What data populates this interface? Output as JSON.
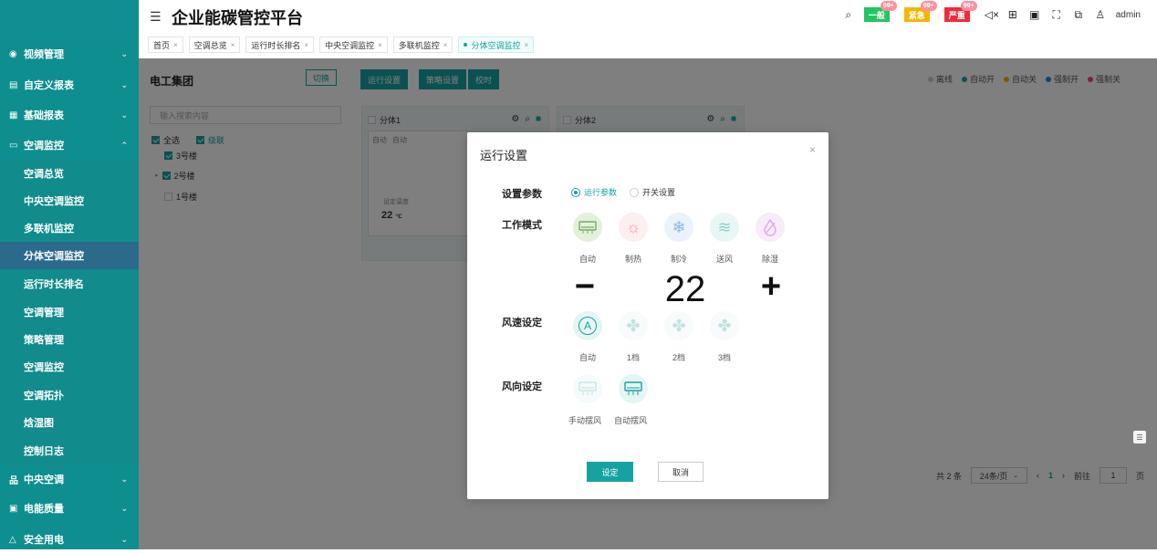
{
  "header": {
    "title": "企业能碳管控平台",
    "user": "admin",
    "alerts": [
      {
        "label": "一般",
        "count": "99+",
        "color": "#22c55e"
      },
      {
        "label": "紧急",
        "count": "99+",
        "color": "#f5b400"
      },
      {
        "label": "严重",
        "count": "99+",
        "color": "#ef2b3b"
      }
    ],
    "tabs": [
      "首页",
      "空调总览",
      "运行时长排名",
      "中央空调监控",
      "多联机监控",
      "分体空调监控"
    ]
  },
  "sidebar": {
    "items": [
      {
        "label": "视频管理",
        "icon": "video-icon"
      },
      {
        "label": "自定义报表",
        "icon": "report-icon"
      },
      {
        "label": "基础报表",
        "icon": "base-report-icon"
      },
      {
        "label": "空调监控",
        "icon": "ac-icon"
      }
    ],
    "sub_items": [
      "空调总览",
      "中央空调监控",
      "多联机监控",
      "分体空调监控",
      "运行时长排名",
      "空调管理",
      "策略管理",
      "空调监控",
      "空调拓扑",
      "焓湿图",
      "控制日志"
    ],
    "bottom_items": [
      {
        "label": "中央空调",
        "icon": "central-ac-icon"
      },
      {
        "label": "电能质量",
        "icon": "power-quality-icon"
      },
      {
        "label": "安全用电",
        "icon": "safety-icon"
      }
    ]
  },
  "left_panel": {
    "title": "电工集团",
    "switch_label": "切换",
    "search_placeholder": "输入搜索内容",
    "select_all": "全选",
    "cascade": "级联",
    "tree": [
      "3号楼",
      "2号楼",
      "1号楼"
    ]
  },
  "toolbar": {
    "run_settings": "运行设置",
    "strategy_settings": "策略设置",
    "time_sync": "校时"
  },
  "legend": [
    {
      "label": "离线",
      "color": "#cccccc"
    },
    {
      "label": "自动开",
      "color": "#17a2a2"
    },
    {
      "label": "自动关",
      "color": "#f5b400"
    },
    {
      "label": "强制开",
      "color": "#1e88e5"
    },
    {
      "label": "强制关",
      "color": "#ef4b6a"
    }
  ],
  "cards": [
    {
      "title": "分体1",
      "mode1": "自动",
      "mode2": "自动",
      "set_label": "设定温度",
      "temp": "22",
      "unit": "℃"
    },
    {
      "title": "分体2"
    }
  ],
  "pager": {
    "total": "共 2 条",
    "page_size": "24条/页",
    "current": "1",
    "goto": "前往",
    "goto_value": "1",
    "page_suffix": "页"
  },
  "modal": {
    "title": "运行设置",
    "param_label": "设置参数",
    "radio_run": "运行参数",
    "radio_switch": "开关设置",
    "work_mode_label": "工作模式",
    "modes": [
      "自动",
      "制热",
      "制冷",
      "送风",
      "除湿"
    ],
    "temperature": "22",
    "minus": "−",
    "plus": "+",
    "fan_label": "风速设定",
    "fan_speeds": [
      "自动",
      "1档",
      "2档",
      "3档"
    ],
    "direction_label": "风向设定",
    "directions": [
      "手动摆风",
      "自动摆风"
    ],
    "ok": "设定",
    "cancel": "取消"
  }
}
